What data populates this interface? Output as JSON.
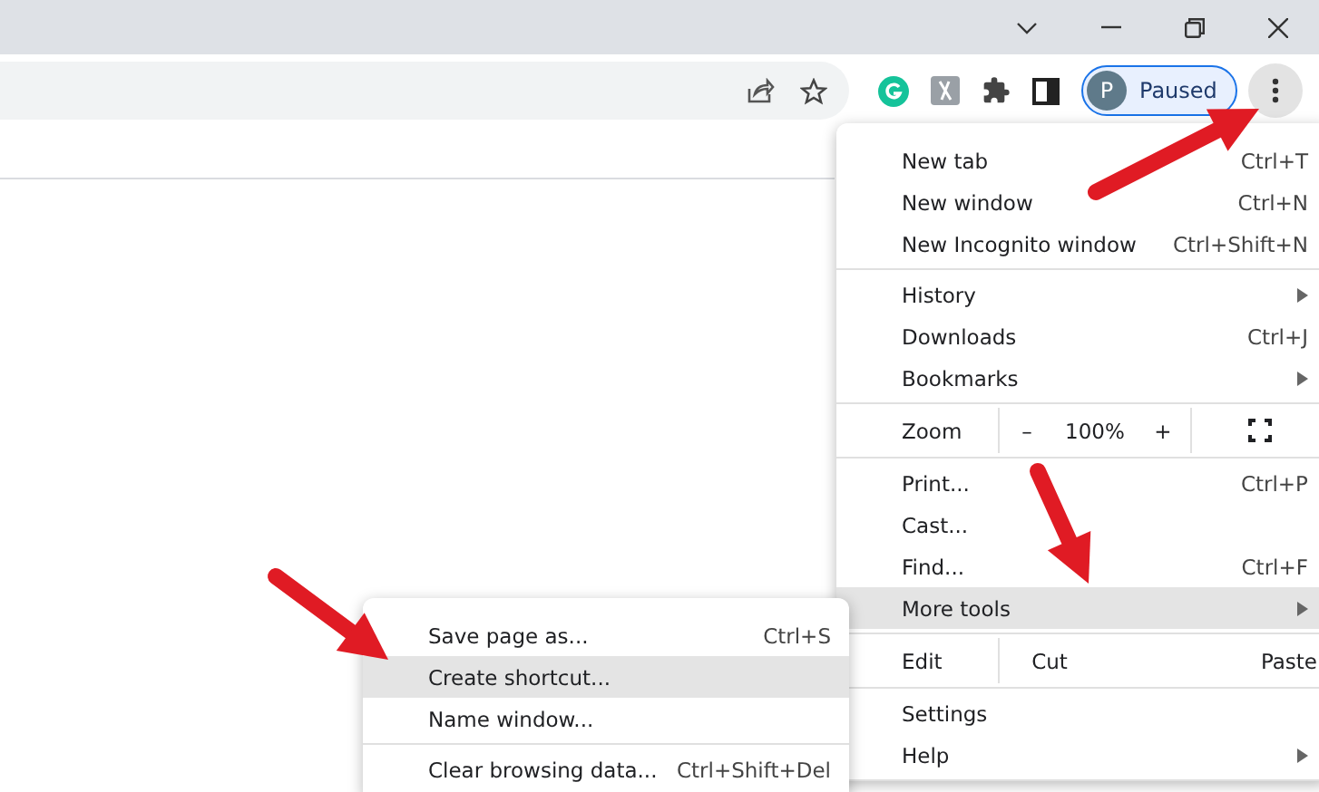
{
  "profile": {
    "initial": "P",
    "label": "Paused"
  },
  "menu": {
    "sections": [
      [
        {
          "kind": "item",
          "label": "New tab",
          "shortcut": "Ctrl+T",
          "submenu": false,
          "selected": false
        },
        {
          "kind": "item",
          "label": "New window",
          "shortcut": "Ctrl+N",
          "submenu": false,
          "selected": false
        },
        {
          "kind": "item",
          "label": "New Incognito window",
          "shortcut": "Ctrl+Shift+N",
          "submenu": false,
          "selected": false
        }
      ],
      [
        {
          "kind": "item",
          "label": "History",
          "submenu": true,
          "selected": false
        },
        {
          "kind": "item",
          "label": "Downloads",
          "shortcut": "Ctrl+J",
          "submenu": false,
          "selected": false
        },
        {
          "kind": "item",
          "label": "Bookmarks",
          "submenu": true,
          "selected": false
        }
      ],
      [
        {
          "kind": "zoom",
          "label": "Zoom",
          "minus": "–",
          "value": "100%",
          "plus": "+"
        }
      ],
      [
        {
          "kind": "item",
          "label": "Print...",
          "shortcut": "Ctrl+P",
          "submenu": false,
          "selected": false
        },
        {
          "kind": "item",
          "label": "Cast...",
          "submenu": false,
          "selected": false
        },
        {
          "kind": "item",
          "label": "Find...",
          "shortcut": "Ctrl+F",
          "submenu": false,
          "selected": false
        },
        {
          "kind": "item",
          "label": "More tools",
          "submenu": true,
          "selected": true
        }
      ],
      [
        {
          "kind": "edit",
          "label": "Edit",
          "actions": [
            "Cut",
            "Paste"
          ]
        }
      ],
      [
        {
          "kind": "item",
          "label": "Settings",
          "submenu": false,
          "selected": false
        },
        {
          "kind": "item",
          "label": "Help",
          "submenu": true,
          "selected": false
        }
      ]
    ]
  },
  "submenu": {
    "sections": [
      [
        {
          "kind": "item",
          "label": "Save page as...",
          "shortcut": "Ctrl+S",
          "submenu": false,
          "selected": false
        },
        {
          "kind": "item",
          "label": "Create shortcut...",
          "submenu": false,
          "selected": true
        },
        {
          "kind": "item",
          "label": "Name window...",
          "submenu": false,
          "selected": false
        }
      ],
      [
        {
          "kind": "item",
          "label": "Clear browsing data...",
          "shortcut": "Ctrl+Shift+Del",
          "submenu": false,
          "selected": false
        }
      ]
    ]
  }
}
